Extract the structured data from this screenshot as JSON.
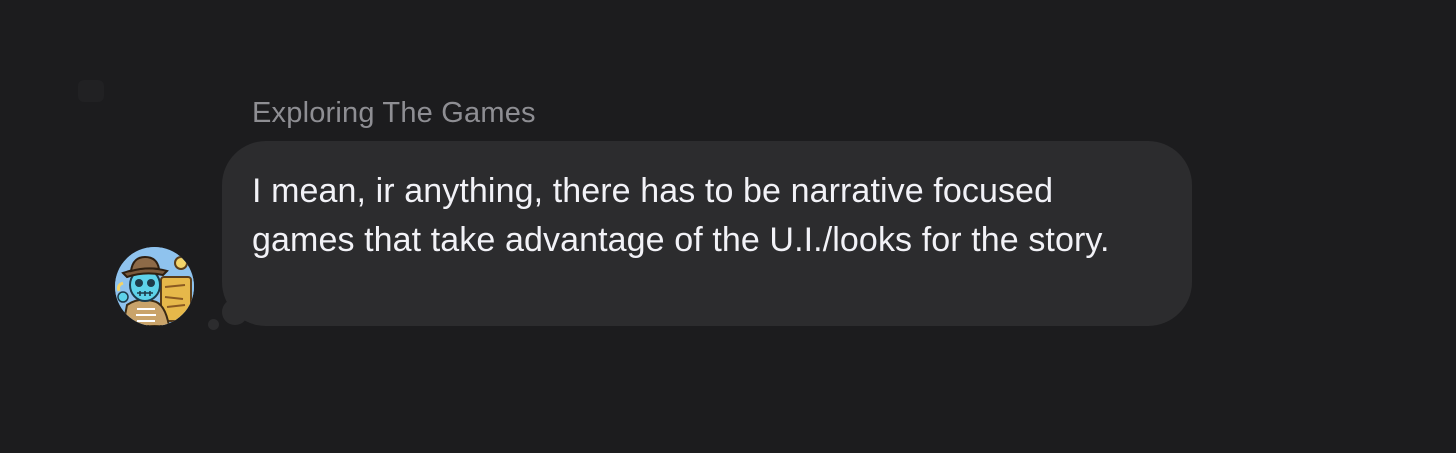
{
  "conversation": {
    "sender": {
      "name": "Exploring The Games",
      "avatar_icon": "skeleton-explorer-avatar"
    },
    "message": {
      "text": "I mean, ir anything, there has to be narrative focused games that take advantage of the U.I./looks for the story.",
      "style": "thought-bubble"
    }
  },
  "colors": {
    "background": "#1c1c1e",
    "bubble": "#2c2c2e",
    "sender_name": "#8e8e93",
    "message_text": "#f2f2f7"
  }
}
